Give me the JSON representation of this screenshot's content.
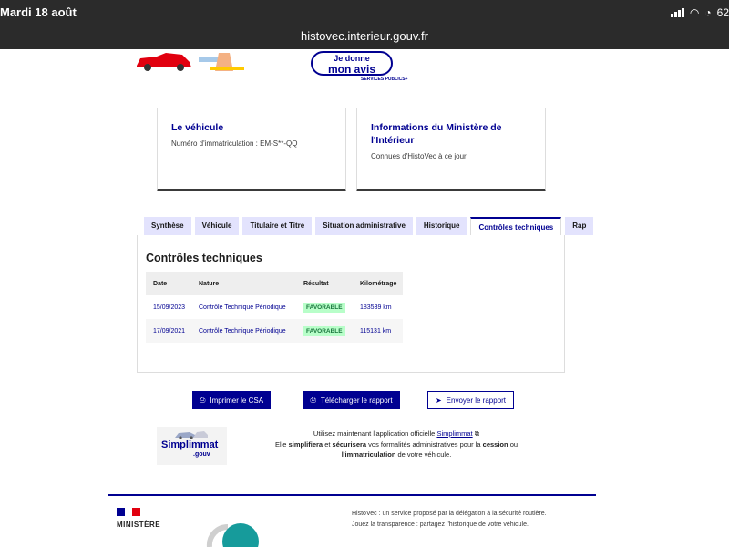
{
  "status": {
    "date": "Mardi 18 août",
    "battery": "62"
  },
  "browser": {
    "url": "histovec.interieur.gouv.fr"
  },
  "promo": {
    "avis_line1": "Je donne",
    "avis_line2": "mon avis",
    "services": "SERVICES PUBLICS+"
  },
  "cards": [
    {
      "title": "Le véhicule",
      "text": "Numéro d'immatriculation : EM-S**-QQ"
    },
    {
      "title": "Informations du Ministère de l'Intérieur",
      "text": "Connues d'HistoVec à ce jour"
    }
  ],
  "tabs": [
    {
      "label": "Synthèse"
    },
    {
      "label": "Véhicule"
    },
    {
      "label": "Titulaire et Titre"
    },
    {
      "label": "Situation administrative"
    },
    {
      "label": "Historique"
    },
    {
      "label": "Contrôles techniques",
      "active": true
    },
    {
      "label": "Rap"
    }
  ],
  "controles": {
    "title": "Contrôles techniques",
    "columns": [
      "Date",
      "Nature",
      "Résultat",
      "Kilométrage"
    ],
    "rows": [
      {
        "date": "15/09/2023",
        "nature": "Contrôle Technique Périodique",
        "resultat": "FAVORABLE",
        "km": "183539 km"
      },
      {
        "date": "17/09/2021",
        "nature": "Contrôle Technique Périodique",
        "resultat": "FAVORABLE",
        "km": "115131 km"
      }
    ]
  },
  "actions": {
    "print": "Imprimer le CSA",
    "download": "Télécharger le rapport",
    "send": "Envoyer le rapport"
  },
  "simplimmat": {
    "logo_word": "Simplimmat",
    "logo_gouv": ".gouv",
    "line1_pre": "Utilisez maintenant l'application officielle",
    "link": "Simplimmat",
    "line2_a": "Elle",
    "line2_b": "simplifiera",
    "line2_c": "et",
    "line2_d": "sécurisera",
    "line2_e": "vos formalités administratives pour la",
    "line2_f": "cession",
    "line2_g": "ou",
    "line3_a": "l'immatriculation",
    "line3_b": "de votre véhicule."
  },
  "footer": {
    "ministere": "MINISTÈRE",
    "text1": "HistoVec : un service proposé par la délégation à la sécurité routière.",
    "text2": "Jouez la transparence : partagez l'historique de votre véhicule."
  },
  "colors": {
    "primary": "#000091",
    "tab_bg": "#e3e3fd",
    "favorable_bg": "#b8fec9",
    "favorable_text": "#18753c"
  }
}
